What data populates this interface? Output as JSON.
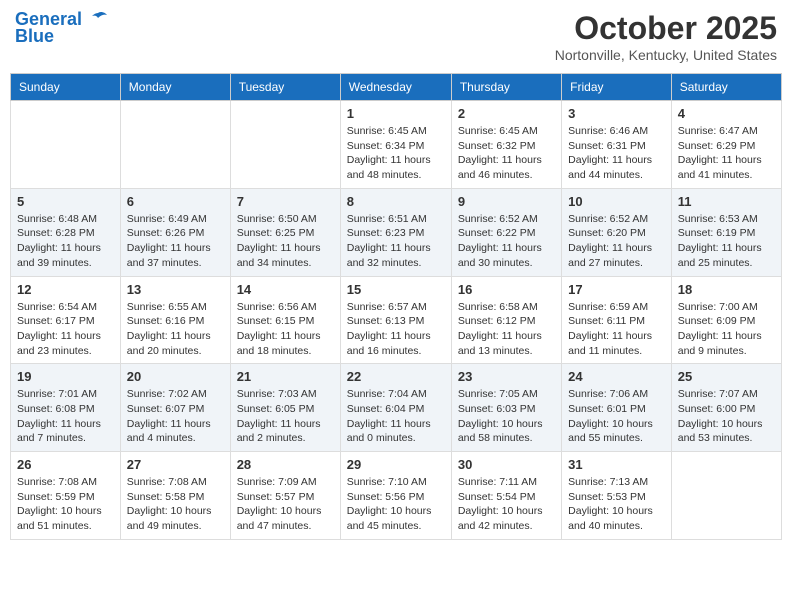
{
  "header": {
    "logo_line1": "General",
    "logo_line2": "Blue",
    "month": "October 2025",
    "location": "Nortonville, Kentucky, United States"
  },
  "weekdays": [
    "Sunday",
    "Monday",
    "Tuesday",
    "Wednesday",
    "Thursday",
    "Friday",
    "Saturday"
  ],
  "weeks": [
    [
      {
        "day": "",
        "info": ""
      },
      {
        "day": "",
        "info": ""
      },
      {
        "day": "",
        "info": ""
      },
      {
        "day": "1",
        "info": "Sunrise: 6:45 AM\nSunset: 6:34 PM\nDaylight: 11 hours\nand 48 minutes."
      },
      {
        "day": "2",
        "info": "Sunrise: 6:45 AM\nSunset: 6:32 PM\nDaylight: 11 hours\nand 46 minutes."
      },
      {
        "day": "3",
        "info": "Sunrise: 6:46 AM\nSunset: 6:31 PM\nDaylight: 11 hours\nand 44 minutes."
      },
      {
        "day": "4",
        "info": "Sunrise: 6:47 AM\nSunset: 6:29 PM\nDaylight: 11 hours\nand 41 minutes."
      }
    ],
    [
      {
        "day": "5",
        "info": "Sunrise: 6:48 AM\nSunset: 6:28 PM\nDaylight: 11 hours\nand 39 minutes."
      },
      {
        "day": "6",
        "info": "Sunrise: 6:49 AM\nSunset: 6:26 PM\nDaylight: 11 hours\nand 37 minutes."
      },
      {
        "day": "7",
        "info": "Sunrise: 6:50 AM\nSunset: 6:25 PM\nDaylight: 11 hours\nand 34 minutes."
      },
      {
        "day": "8",
        "info": "Sunrise: 6:51 AM\nSunset: 6:23 PM\nDaylight: 11 hours\nand 32 minutes."
      },
      {
        "day": "9",
        "info": "Sunrise: 6:52 AM\nSunset: 6:22 PM\nDaylight: 11 hours\nand 30 minutes."
      },
      {
        "day": "10",
        "info": "Sunrise: 6:52 AM\nSunset: 6:20 PM\nDaylight: 11 hours\nand 27 minutes."
      },
      {
        "day": "11",
        "info": "Sunrise: 6:53 AM\nSunset: 6:19 PM\nDaylight: 11 hours\nand 25 minutes."
      }
    ],
    [
      {
        "day": "12",
        "info": "Sunrise: 6:54 AM\nSunset: 6:17 PM\nDaylight: 11 hours\nand 23 minutes."
      },
      {
        "day": "13",
        "info": "Sunrise: 6:55 AM\nSunset: 6:16 PM\nDaylight: 11 hours\nand 20 minutes."
      },
      {
        "day": "14",
        "info": "Sunrise: 6:56 AM\nSunset: 6:15 PM\nDaylight: 11 hours\nand 18 minutes."
      },
      {
        "day": "15",
        "info": "Sunrise: 6:57 AM\nSunset: 6:13 PM\nDaylight: 11 hours\nand 16 minutes."
      },
      {
        "day": "16",
        "info": "Sunrise: 6:58 AM\nSunset: 6:12 PM\nDaylight: 11 hours\nand 13 minutes."
      },
      {
        "day": "17",
        "info": "Sunrise: 6:59 AM\nSunset: 6:11 PM\nDaylight: 11 hours\nand 11 minutes."
      },
      {
        "day": "18",
        "info": "Sunrise: 7:00 AM\nSunset: 6:09 PM\nDaylight: 11 hours\nand 9 minutes."
      }
    ],
    [
      {
        "day": "19",
        "info": "Sunrise: 7:01 AM\nSunset: 6:08 PM\nDaylight: 11 hours\nand 7 minutes."
      },
      {
        "day": "20",
        "info": "Sunrise: 7:02 AM\nSunset: 6:07 PM\nDaylight: 11 hours\nand 4 minutes."
      },
      {
        "day": "21",
        "info": "Sunrise: 7:03 AM\nSunset: 6:05 PM\nDaylight: 11 hours\nand 2 minutes."
      },
      {
        "day": "22",
        "info": "Sunrise: 7:04 AM\nSunset: 6:04 PM\nDaylight: 11 hours\nand 0 minutes."
      },
      {
        "day": "23",
        "info": "Sunrise: 7:05 AM\nSunset: 6:03 PM\nDaylight: 10 hours\nand 58 minutes."
      },
      {
        "day": "24",
        "info": "Sunrise: 7:06 AM\nSunset: 6:01 PM\nDaylight: 10 hours\nand 55 minutes."
      },
      {
        "day": "25",
        "info": "Sunrise: 7:07 AM\nSunset: 6:00 PM\nDaylight: 10 hours\nand 53 minutes."
      }
    ],
    [
      {
        "day": "26",
        "info": "Sunrise: 7:08 AM\nSunset: 5:59 PM\nDaylight: 10 hours\nand 51 minutes."
      },
      {
        "day": "27",
        "info": "Sunrise: 7:08 AM\nSunset: 5:58 PM\nDaylight: 10 hours\nand 49 minutes."
      },
      {
        "day": "28",
        "info": "Sunrise: 7:09 AM\nSunset: 5:57 PM\nDaylight: 10 hours\nand 47 minutes."
      },
      {
        "day": "29",
        "info": "Sunrise: 7:10 AM\nSunset: 5:56 PM\nDaylight: 10 hours\nand 45 minutes."
      },
      {
        "day": "30",
        "info": "Sunrise: 7:11 AM\nSunset: 5:54 PM\nDaylight: 10 hours\nand 42 minutes."
      },
      {
        "day": "31",
        "info": "Sunrise: 7:13 AM\nSunset: 5:53 PM\nDaylight: 10 hours\nand 40 minutes."
      },
      {
        "day": "",
        "info": ""
      }
    ]
  ]
}
